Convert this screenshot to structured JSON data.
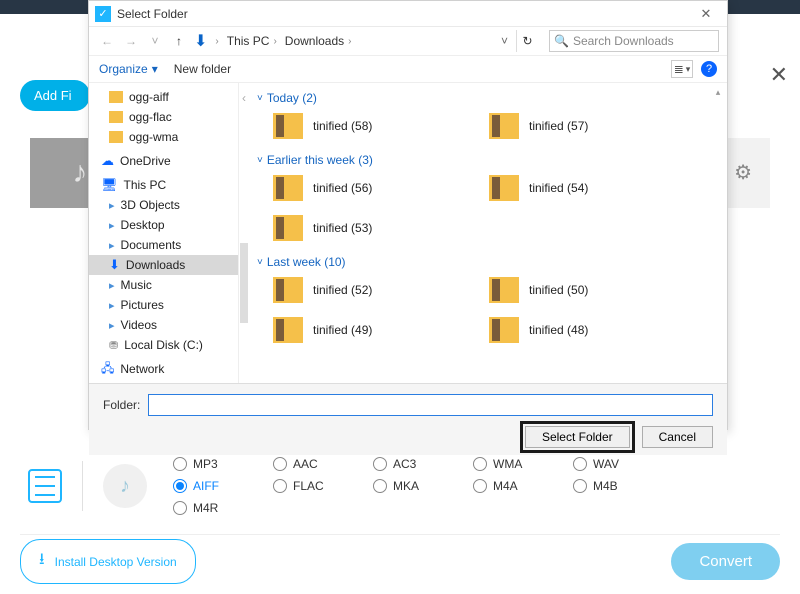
{
  "app": {
    "add_files_label": "Add Fi",
    "close_x": "✕"
  },
  "dialog": {
    "title": "Select Folder",
    "nav": {
      "back": "←",
      "forward": "→",
      "drop": "˅",
      "up": "↑"
    },
    "path": {
      "seg1": "This PC",
      "seg2": "Downloads"
    },
    "path_drop": "˅",
    "refresh": "↻",
    "search_placeholder": "Search Downloads",
    "toolbar": {
      "organize": "Organize",
      "new_folder": "New folder",
      "view_drop": "▾",
      "help": "?"
    },
    "tree": {
      "items": [
        {
          "label": "ogg-aiff",
          "icon": "folder"
        },
        {
          "label": "ogg-flac",
          "icon": "folder"
        },
        {
          "label": "ogg-wma",
          "icon": "folder"
        },
        {
          "label": "OneDrive",
          "icon": "cloud",
          "root": true
        },
        {
          "label": "This PC",
          "icon": "pc",
          "root": true
        },
        {
          "label": "3D Objects",
          "icon": "mini"
        },
        {
          "label": "Desktop",
          "icon": "mini"
        },
        {
          "label": "Documents",
          "icon": "mini"
        },
        {
          "label": "Downloads",
          "icon": "dl",
          "selected": true
        },
        {
          "label": "Music",
          "icon": "mini"
        },
        {
          "label": "Pictures",
          "icon": "mini"
        },
        {
          "label": "Videos",
          "icon": "mini"
        },
        {
          "label": "Local Disk (C:)",
          "icon": "disk"
        },
        {
          "label": "Network",
          "icon": "net",
          "root": true
        }
      ]
    },
    "groups": [
      {
        "header": "Today (2)",
        "items": [
          "tinified (58)",
          "tinified (57)"
        ]
      },
      {
        "header": "Earlier this week (3)",
        "items": [
          "tinified (56)",
          "tinified (54)",
          "tinified (53)"
        ]
      },
      {
        "header": "Last week (10)",
        "items": [
          "tinified (52)",
          "tinified (50)",
          "tinified (49)",
          "tinified (48)"
        ]
      }
    ],
    "footer": {
      "folder_label": "Folder:",
      "select_button": "Select Folder",
      "cancel_button": "Cancel"
    }
  },
  "formats": {
    "options": [
      "MP3",
      "AAC",
      "AC3",
      "WMA",
      "WAV",
      "AIFF",
      "FLAC",
      "MKA",
      "M4A",
      "M4B",
      "M4R"
    ],
    "selected": "AIFF"
  },
  "bottom": {
    "install_label": "Install Desktop Version",
    "convert_label": "Convert"
  }
}
